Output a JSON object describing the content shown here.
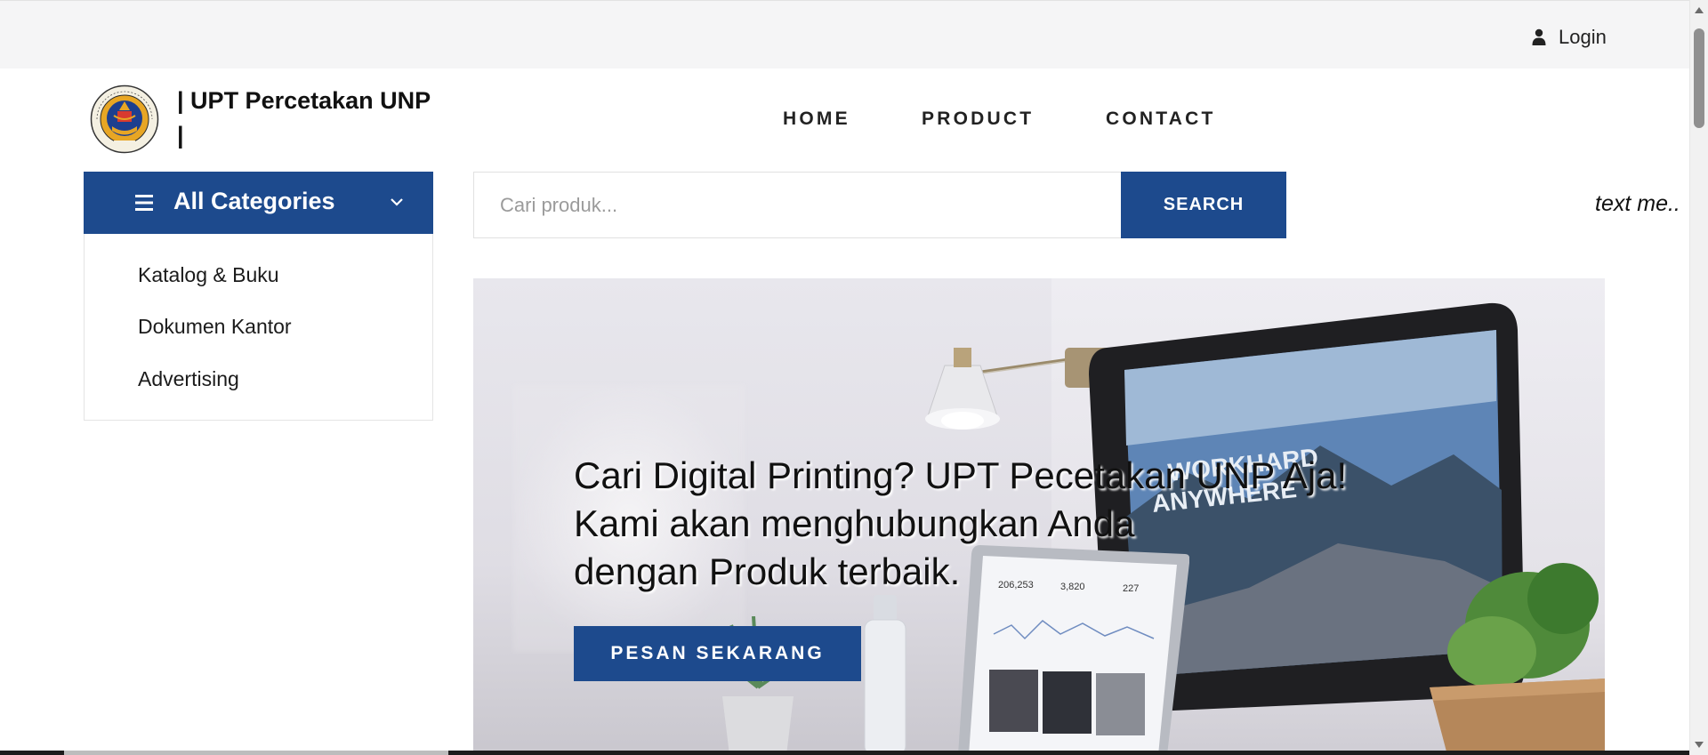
{
  "topbar": {
    "login_label": "Login"
  },
  "brand": {
    "name_line1": "| UPT Percetakan UNP",
    "name_line2": "|"
  },
  "nav": {
    "items": [
      "HOME",
      "PRODUCT",
      "CONTACT"
    ]
  },
  "categories": {
    "title": "All Categories",
    "items": [
      "Katalog & Buku",
      "Dokumen Kantor",
      "Advertising"
    ]
  },
  "search": {
    "placeholder": "Cari produk...",
    "button_label": "SEARCH",
    "value": ""
  },
  "marquee": {
    "text": "text me.."
  },
  "hero": {
    "heading_line1": "Cari Digital Printing? UPT Pecetakan UNP Aja!",
    "heading_line2": "Kami akan menghubungkan Anda",
    "heading_line3": "dengan Produk terbaik.",
    "cta_label": "PESAN SEKARANG",
    "image_texts": {
      "screen_line1": "WORKHARD",
      "screen_line2": "ANYWHERE",
      "stat1": "206,253",
      "stat2": "3,820",
      "stat3": "227"
    }
  },
  "colors": {
    "primary": "#1d4a8d",
    "topbar_bg": "#f5f5f6",
    "logo_gold": "#e8a624",
    "logo_blue": "#1d3f8f"
  },
  "icons": {
    "login": "user-icon",
    "categories": "menu-icon",
    "dropdown": "chevron-down-icon"
  }
}
